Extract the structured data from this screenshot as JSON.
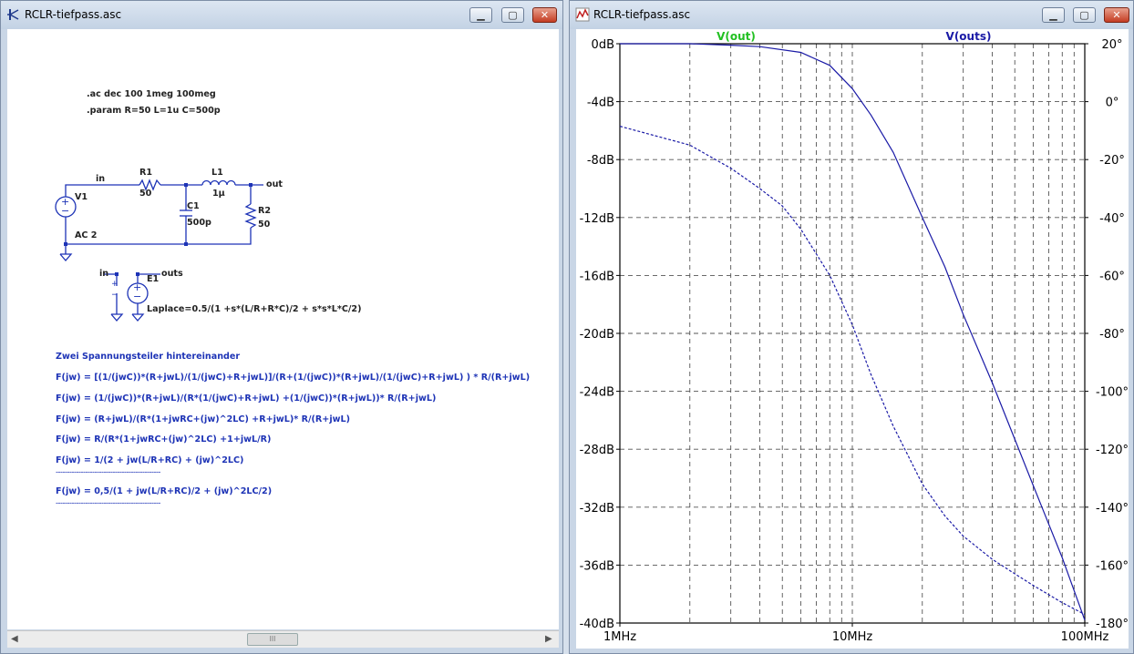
{
  "left_window": {
    "title": "RCLR-tiefpass.asc",
    "btn_min": "▁",
    "btn_max": "▢",
    "btn_close": "✕",
    "directives": [
      ".ac dec 100 1meg 100meg",
      ".param R=50 L=1u C=500p"
    ],
    "components": {
      "v1_name": "V1",
      "v1_value": "AC 2",
      "r1_name": "R1",
      "r1_value": "50",
      "l1_name": "L1",
      "l1_value": "1µ",
      "c1_name": "C1",
      "c1_value": "500p",
      "r2_name": "R2",
      "r2_value": "50",
      "e1_name": "E1",
      "e1_value": "Laplace=0.5/(1 +s*(L/R+R*C)/2 + s*s*L*C/2)",
      "net_in": "in",
      "net_out": "out",
      "net_outs": "outs",
      "net_in2": "in"
    },
    "notes": [
      "Zwei Spannungsteiler hintereinander",
      "F(jw) = [(1/(jwC))*(R+jwL)/(1/(jwC)+R+jwL)]/(R+(1/(jwC))*(R+jwL)/(1/(jwC)+R+jwL) )  * R/(R+jwL)",
      "F(jw) = (1/(jwC))*(R+jwL)/(R*(1/(jwC)+R+jwL) +(1/(jwC))*(R+jwL))* R/(R+jwL)",
      "F(jw) = (R+jwL)/(R*(1+jwRC+(jw)^2LC) +R+jwL)* R/(R+jwL)",
      "F(jw) = R/(R*(1+jwRC+(jw)^2LC) +1+jwL/R)",
      "F(jw) = 1/(2 + jw(L/R+RC) + (jw)^2LC)",
      "F(jw) = 0,5/(1 + jw(L/R+RC)/2 + (jw)^2LC/2)"
    ],
    "separator": "----------------------------------------------",
    "scroll_left": "◀",
    "scroll_right": "▶",
    "scroll_thumb": "III"
  },
  "right_window": {
    "title": "RCLR-tiefpass.asc",
    "btn_min": "▁",
    "btn_max": "▢",
    "btn_close": "✕"
  },
  "chart_data": {
    "type": "line",
    "x_scale": "log",
    "xlim": [
      1000000,
      100000000
    ],
    "x_ticks": [
      "1MHz",
      "10MHz",
      "100MHz"
    ],
    "ylim_left": [
      -40,
      0
    ],
    "y_ticks_left": [
      "0dB",
      "-4dB",
      "-8dB",
      "-12dB",
      "-16dB",
      "-20dB",
      "-24dB",
      "-28dB",
      "-32dB",
      "-36dB",
      "-40dB"
    ],
    "ylim_right": [
      -180,
      20
    ],
    "y_ticks_right": [
      "20°",
      "0°",
      "-20°",
      "-40°",
      "-60°",
      "-80°",
      "-100°",
      "-120°",
      "-140°",
      "-160°",
      "-180°"
    ],
    "grid": true,
    "trace_labels": [
      {
        "name": "V(out)",
        "color": "#22c022"
      },
      {
        "name": "V(outs)",
        "color": "#1a1aa6"
      }
    ],
    "series": [
      {
        "name": "V(outs)",
        "quantity": "magnitude",
        "unit": "dB",
        "axis": "left",
        "color": "#1a1aa6",
        "style": "solid",
        "x": [
          1000000,
          2000000,
          3000000,
          4000000,
          6000000,
          8000000,
          10000000,
          12000000,
          15000000,
          20000000,
          25000000,
          30000000,
          40000000,
          50000000,
          60000000,
          80000000,
          100000000
        ],
        "y": [
          0,
          0,
          -0.1,
          -0.2,
          -0.6,
          -1.5,
          -3.1,
          -4.9,
          -7.5,
          -12.0,
          -15.4,
          -18.7,
          -23.4,
          -27.3,
          -30.5,
          -35.5,
          -39.8
        ]
      },
      {
        "name": "V(outs)",
        "quantity": "phase",
        "unit": "°",
        "axis": "right",
        "color": "#1a1aa6",
        "style": "dashed",
        "x": [
          1000000,
          2000000,
          3000000,
          4000000,
          5000000,
          6000000,
          8000000,
          10000000,
          12000000,
          15000000,
          20000000,
          25000000,
          30000000,
          40000000,
          50000000,
          60000000,
          80000000,
          100000000
        ],
        "y": [
          -8.5,
          -15,
          -23,
          -30,
          -36,
          -44,
          -60,
          -77,
          -94,
          -112,
          -132,
          -143,
          -150,
          -158,
          -163,
          -167,
          -173,
          -177
        ]
      }
    ]
  }
}
